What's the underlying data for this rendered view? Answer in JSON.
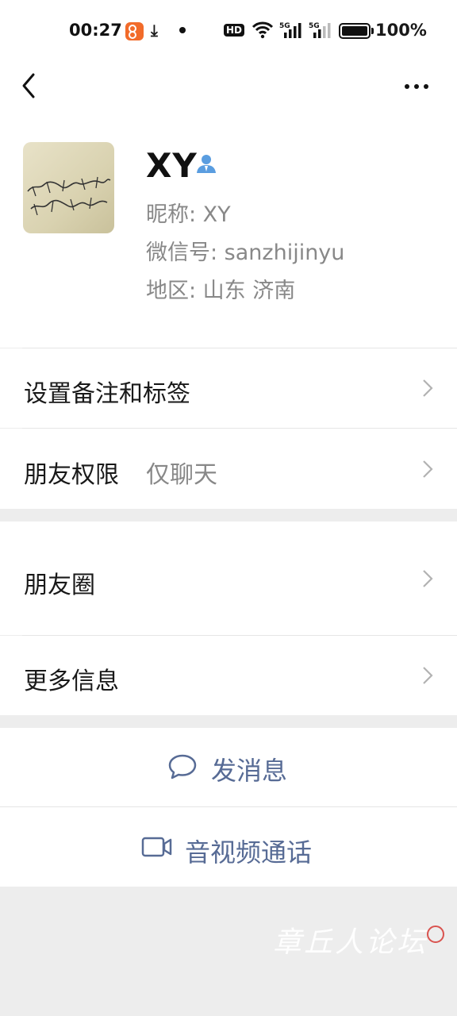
{
  "status_bar": {
    "time": "00:27",
    "hd_label": "HD",
    "signal_label": "5G",
    "battery_text": "100%"
  },
  "profile": {
    "name": "XY",
    "nickname": "昵称:  XY",
    "wechat_id": "微信号:  sanzhijinyu",
    "region": "地区:  山东  济南"
  },
  "menu": {
    "remark_label": "设置备注和标签",
    "permission_label": "朋友权限",
    "permission_value": "仅聊天",
    "moments_label": "朋友圈",
    "more_info_label": "更多信息"
  },
  "actions": {
    "message": "发消息",
    "video_call": "音视频通话"
  },
  "watermark": "章丘人论坛",
  "colors": {
    "link_blue": "#576b95",
    "background": "#ededed",
    "secondary_text": "#888888"
  },
  "icons": [
    "back-arrow-icon",
    "more-dots-icon",
    "person-icon",
    "chevron-right-icon",
    "chat-bubble-icon",
    "video-camera-icon"
  ]
}
